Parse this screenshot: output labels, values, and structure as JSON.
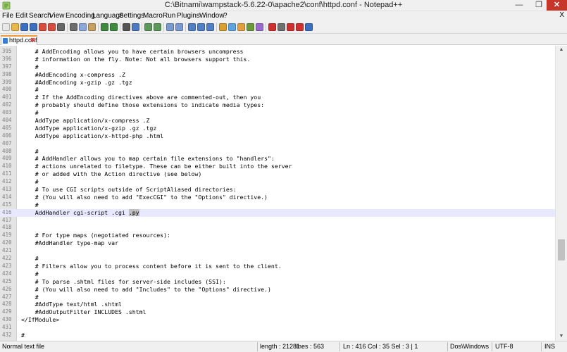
{
  "window": {
    "title": "C:\\Bitnami\\wampstack-5.6.22-0\\apache2\\conf\\httpd.conf - Notepad++",
    "min_symbol": "—",
    "max_symbol": "❐",
    "close_symbol": "✕"
  },
  "menu": {
    "items": [
      "File",
      "Edit",
      "Search",
      "View",
      "Encoding",
      "Language",
      "Settings",
      "Macro",
      "Run",
      "Plugins",
      "Window",
      "?"
    ],
    "close_symbol": "X"
  },
  "toolbar": {
    "buttons": [
      {
        "icon": "new-file-icon",
        "color": "#e8e8e8"
      },
      {
        "icon": "open-file-icon",
        "color": "#e9b84a"
      },
      {
        "icon": "save-icon",
        "color": "#3a6fc2"
      },
      {
        "icon": "save-all-icon",
        "color": "#3a6fc2"
      },
      {
        "icon": "close-icon",
        "color": "#d94b3e"
      },
      {
        "icon": "close-all-icon",
        "color": "#d94b3e"
      },
      {
        "icon": "print-icon",
        "color": "#666666"
      },
      {
        "icon": "cut-icon",
        "color": "#6d6d6d"
      },
      {
        "icon": "copy-icon",
        "color": "#8aa8d8"
      },
      {
        "icon": "paste-icon",
        "color": "#c8a060"
      },
      {
        "icon": "undo-icon",
        "color": "#3e8a3e"
      },
      {
        "icon": "redo-icon",
        "color": "#3e8a3e"
      },
      {
        "icon": "find-icon",
        "color": "#555555"
      },
      {
        "icon": "replace-icon",
        "color": "#4a7ac0"
      },
      {
        "icon": "zoom-in-icon",
        "color": "#5c9a5c"
      },
      {
        "icon": "zoom-out-icon",
        "color": "#5c9a5c"
      },
      {
        "icon": "sync-v-icon",
        "color": "#7a9ad0"
      },
      {
        "icon": "sync-h-icon",
        "color": "#7a9ad0"
      },
      {
        "icon": "word-wrap-icon",
        "color": "#4f7fc4"
      },
      {
        "icon": "show-all-chars-icon",
        "color": "#4f7fc4"
      },
      {
        "icon": "indent-guide-icon",
        "color": "#4f7fc4"
      },
      {
        "icon": "udl-icon",
        "color": "#d9a02f"
      },
      {
        "icon": "doc-map-icon",
        "color": "#5fa4e0"
      },
      {
        "icon": "function-list-icon",
        "color": "#e0a040"
      },
      {
        "icon": "folder-workspace-icon",
        "color": "#6a9a3a"
      },
      {
        "icon": "monitoring-icon",
        "color": "#9a6ad0"
      },
      {
        "icon": "record-macro-icon",
        "color": "#d03030"
      },
      {
        "icon": "stop-macro-icon",
        "color": "#707070"
      },
      {
        "icon": "play-macro-icon",
        "color": "#d03030"
      },
      {
        "icon": "run-macro-icon",
        "color": "#d03030"
      },
      {
        "icon": "save-macro-icon",
        "color": "#3a6fc2"
      }
    ]
  },
  "tab": {
    "label": "httpd.conf",
    "close_symbol": "⊠"
  },
  "editor": {
    "current_line": "416",
    "lines": [
      {
        "n": "395",
        "t": "    # AddEncoding allows you to have certain browsers uncompress"
      },
      {
        "n": "396",
        "t": "    # information on the fly. Note: Not all browsers support this."
      },
      {
        "n": "397",
        "t": "    #"
      },
      {
        "n": "398",
        "t": "    #AddEncoding x-compress .Z"
      },
      {
        "n": "399",
        "t": "    #AddEncoding x-gzip .gz .tgz"
      },
      {
        "n": "400",
        "t": "    #"
      },
      {
        "n": "401",
        "t": "    # If the AddEncoding directives above are commented-out, then you"
      },
      {
        "n": "402",
        "t": "    # probably should define those extensions to indicate media types:"
      },
      {
        "n": "403",
        "t": "    #"
      },
      {
        "n": "404",
        "t": "    AddType application/x-compress .Z"
      },
      {
        "n": "405",
        "t": "    AddType application/x-gzip .gz .tgz"
      },
      {
        "n": "406",
        "t": "    AddType application/x-httpd-php .html"
      },
      {
        "n": "407",
        "t": ""
      },
      {
        "n": "408",
        "t": "    #"
      },
      {
        "n": "409",
        "t": "    # AddHandler allows you to map certain file extensions to \"handlers\":"
      },
      {
        "n": "410",
        "t": "    # actions unrelated to filetype. These can be either built into the server"
      },
      {
        "n": "411",
        "t": "    # or added with the Action directive (see below)"
      },
      {
        "n": "412",
        "t": "    #"
      },
      {
        "n": "413",
        "t": "    # To use CGI scripts outside of ScriptAliased directories:"
      },
      {
        "n": "414",
        "t": "    # (You will also need to add \"ExecCGI\" to the \"Options\" directive.)"
      },
      {
        "n": "415",
        "t": "    #"
      },
      {
        "n": "416",
        "t": "    AddHandler cgi-script .cgi ",
        "sel": ".py"
      },
      {
        "n": "417",
        "t": ""
      },
      {
        "n": "418",
        "t": ""
      },
      {
        "n": "419",
        "t": "    # For type maps (negotiated resources):"
      },
      {
        "n": "420",
        "t": "    #AddHandler type-map var"
      },
      {
        "n": "421",
        "t": ""
      },
      {
        "n": "422",
        "t": "    #"
      },
      {
        "n": "423",
        "t": "    # Filters allow you to process content before it is sent to the client."
      },
      {
        "n": "424",
        "t": "    #"
      },
      {
        "n": "425",
        "t": "    # To parse .shtml files for server-side includes (SSI):"
      },
      {
        "n": "426",
        "t": "    # (You will also need to add \"Includes\" to the \"Options\" directive.)"
      },
      {
        "n": "427",
        "t": "    #"
      },
      {
        "n": "428",
        "t": "    #AddType text/html .shtml"
      },
      {
        "n": "429",
        "t": "    #AddOutputFilter INCLUDES .shtml"
      },
      {
        "n": "430",
        "t": "</IfModule>"
      },
      {
        "n": "431",
        "t": ""
      },
      {
        "n": "432",
        "t": "#"
      }
    ]
  },
  "scrollbar": {
    "up_symbol": "▲",
    "down_symbol": "▼",
    "position_fraction": 0.72
  },
  "status": {
    "file_type": "Normal text file",
    "length": "length : 21281",
    "lines": "lines : 563",
    "position": "Ln : 416   Col : 35   Sel : 3 | 1",
    "eol": "Dos\\Windows",
    "encoding": "UTF-8",
    "mode": "INS"
  }
}
